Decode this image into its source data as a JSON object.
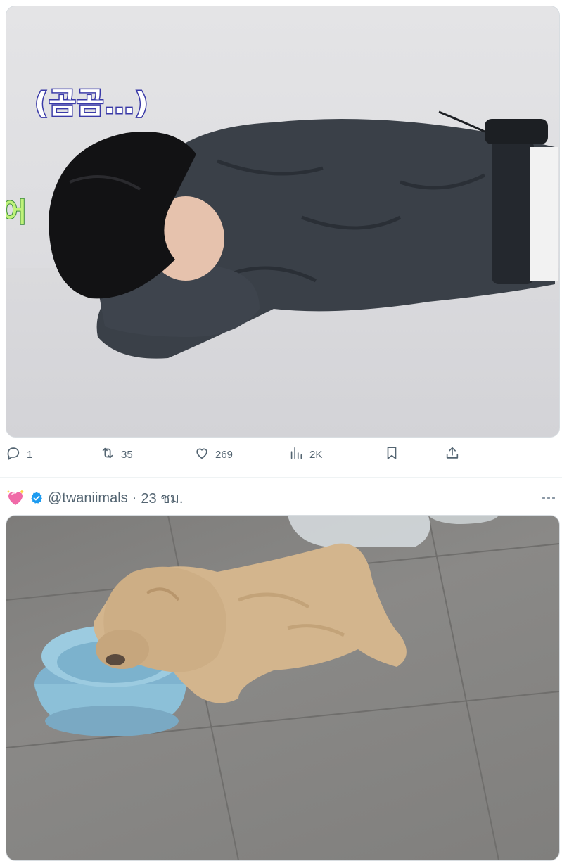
{
  "post1": {
    "image_caption": "(곰곰…)",
    "image_side_text": "어",
    "actions": {
      "replies": "1",
      "reposts": "35",
      "likes": "269",
      "views": "2K"
    }
  },
  "post2": {
    "handle": "@twaniimals",
    "separator": "·",
    "time": "23 ชม."
  },
  "icons": {
    "reply": "reply-icon",
    "repost": "repost-icon",
    "like": "heart-icon",
    "views": "views-icon",
    "bookmark": "bookmark-icon",
    "share": "share-icon",
    "emoji": "sparkling-heart-icon",
    "verified": "verified-badge-icon",
    "more": "more-icon"
  },
  "colors": {
    "muted_text": "#536471",
    "verified_blue": "#1d9bf0",
    "emoji_pink": "#f06aa8"
  }
}
